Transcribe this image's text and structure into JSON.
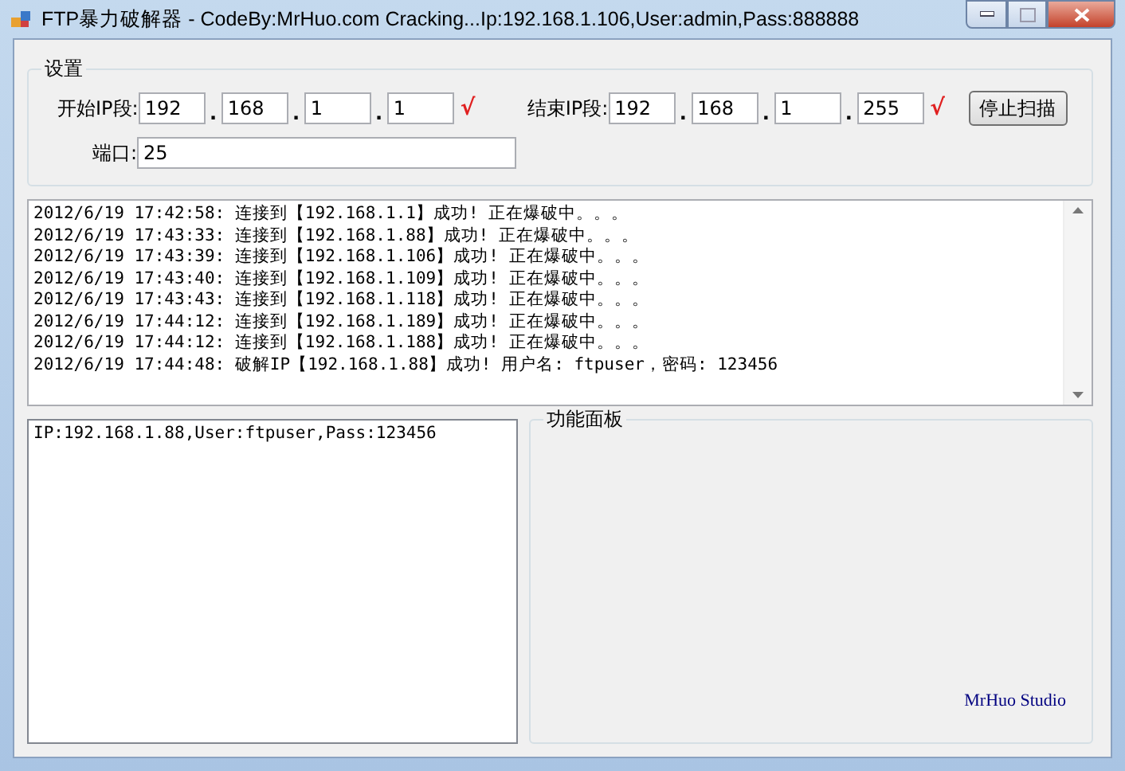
{
  "window": {
    "title": "FTP暴力破解器 - CodeBy:MrHuo.com Cracking...Ip:192.168.1.106,User:admin,Pass:888888"
  },
  "settings": {
    "title": "设置",
    "start_ip": {
      "label": "开始IP段:",
      "octets": [
        {
          "value": "192",
          "separator": "."
        },
        {
          "value": "168",
          "separator": "."
        },
        {
          "value": "1",
          "separator": "."
        },
        {
          "value": "1"
        }
      ],
      "status": "√"
    },
    "end_ip": {
      "label": "结束IP段:",
      "octets": [
        {
          "value": "192",
          "separator": "."
        },
        {
          "value": "168",
          "separator": "."
        },
        {
          "value": "1",
          "separator": "."
        },
        {
          "value": "255"
        }
      ],
      "status": "√"
    },
    "stop_button": "停止扫描",
    "port": {
      "label": "端口:",
      "value": "25"
    }
  },
  "log": [
    "2012/6/19 17:42:58: 连接到【192.168.1.1】成功! 正在爆破中。。。",
    "2012/6/19 17:43:33: 连接到【192.168.1.88】成功! 正在爆破中。。。",
    "2012/6/19 17:43:39: 连接到【192.168.1.106】成功! 正在爆破中。。。",
    "2012/6/19 17:43:40: 连接到【192.168.1.109】成功! 正在爆破中。。。",
    "2012/6/19 17:43:43: 连接到【192.168.1.118】成功! 正在爆破中。。。",
    "2012/6/19 17:44:12: 连接到【192.168.1.189】成功! 正在爆破中。。。",
    "2012/6/19 17:44:12: 连接到【192.168.1.188】成功! 正在爆破中。。。",
    "2012/6/19 17:44:48: 破解IP【192.168.1.88】成功! 用户名: ftpuser，密码: 123456"
  ],
  "results": [
    {
      "text": "IP:192.168.1.88,User:ftpuser,Pass:123456",
      "selected": false
    }
  ],
  "function_panel": {
    "title": "功能面板",
    "credit": "MrHuo Studio"
  }
}
